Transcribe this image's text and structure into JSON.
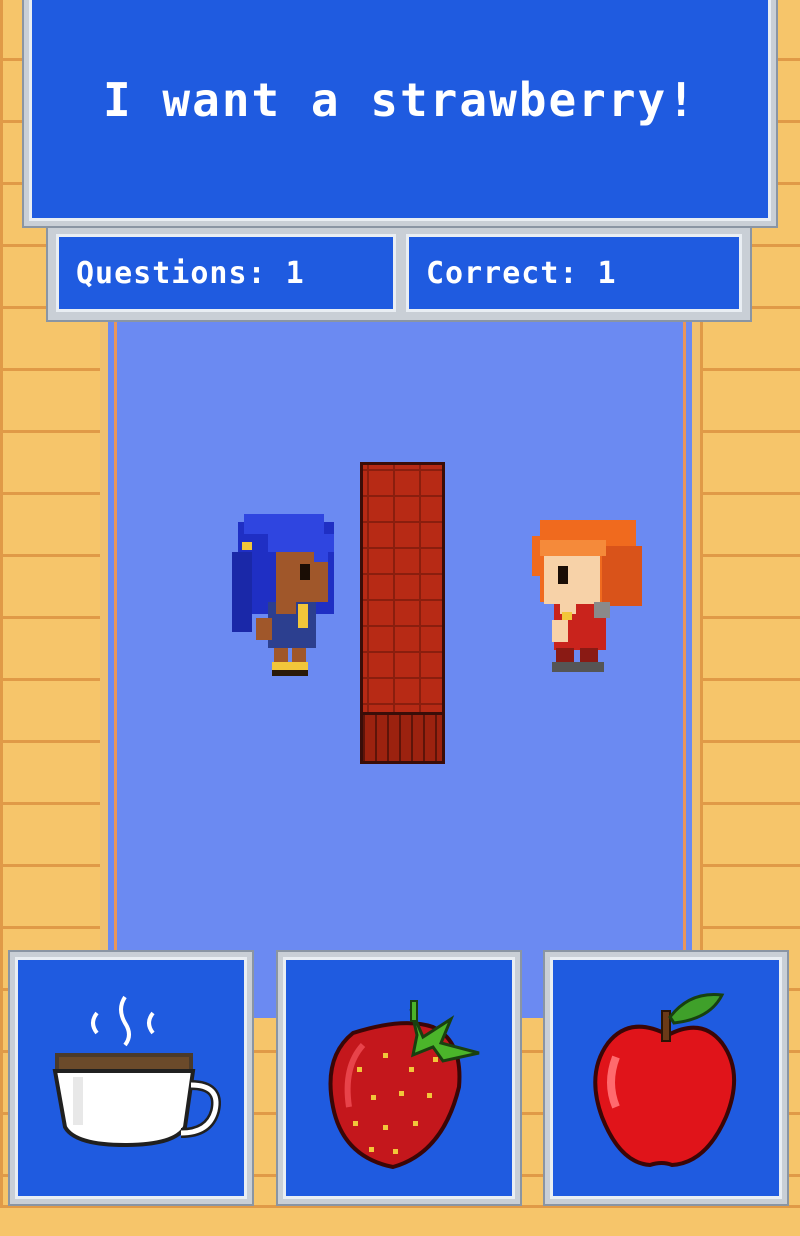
{
  "dialog": {
    "text": "I want a strawberry!"
  },
  "stats": {
    "questions_label": "Questions: 1",
    "correct_label": "Correct: 1",
    "questions": 1,
    "correct": 1
  },
  "characters": {
    "left": "blue-haired-girl",
    "right": "orange-haired-girl"
  },
  "choices": [
    {
      "item": "coffee-cup-icon"
    },
    {
      "item": "strawberry-icon"
    },
    {
      "item": "apple-icon"
    }
  ],
  "colors": {
    "panel": "#1f5be0",
    "floor": "#6b8af2",
    "wall": "#f6c56a",
    "pillar": "#b72a15"
  }
}
